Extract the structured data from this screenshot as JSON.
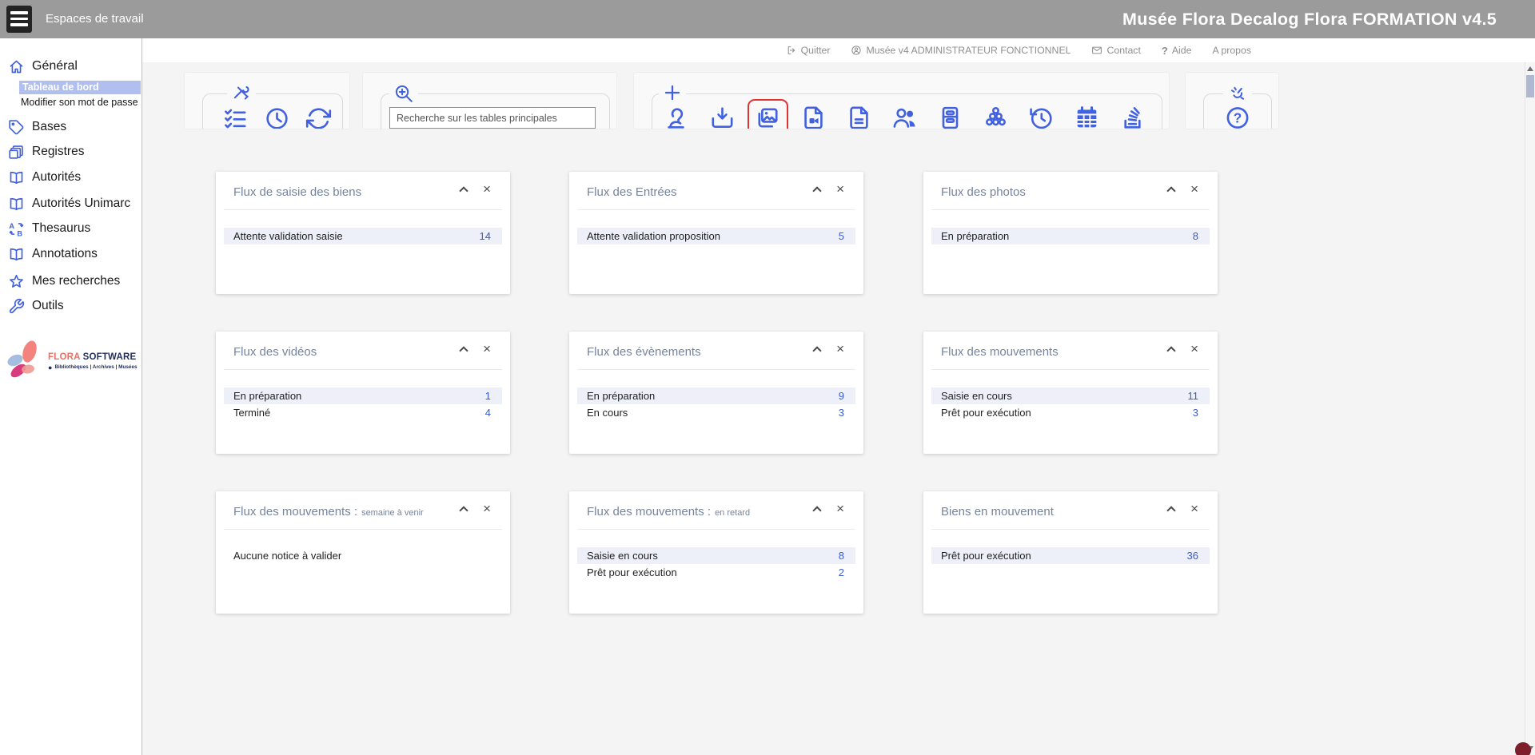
{
  "topbar": {
    "menu_label": "Espaces de travail",
    "title": "Musée Flora Decalog Flora FORMATION v4.5"
  },
  "utility_bar": {
    "items": [
      {
        "icon": "logout-icon",
        "label": "Quitter"
      },
      {
        "icon": "user-circle-icon",
        "label": "Musée v4 ADMINISTRATEUR FONCTIONNEL"
      },
      {
        "icon": "mail-icon",
        "label": "Contact"
      },
      {
        "icon": "question-icon",
        "label": "Aide"
      },
      {
        "icon": "",
        "label": "A propos"
      }
    ]
  },
  "sidebar": {
    "items": [
      {
        "label": "Général",
        "icon": "home-icon",
        "level": "section"
      },
      {
        "label": "Tableau de bord",
        "level": "sub",
        "selected": true
      },
      {
        "label": "Modifier son mot de passe",
        "level": "sub"
      },
      {
        "label": "Bases",
        "icon": "tag-icon"
      },
      {
        "label": "Registres",
        "icon": "registers-icon"
      },
      {
        "label": "Autorités",
        "icon": "book-open-icon"
      },
      {
        "label": "Autorités Unimarc",
        "icon": "book-open-icon"
      },
      {
        "label": "Thesaurus",
        "icon": "thesaurus-icon"
      },
      {
        "label": "Annotations",
        "icon": "book-open-icon"
      },
      {
        "label": "Mes recherches",
        "icon": "star-icon"
      },
      {
        "label": "Outils",
        "icon": "wrench-icon"
      }
    ],
    "logo": {
      "brand_primary": "FLORA",
      "brand_secondary": "SOFTWARE",
      "bullet": "●",
      "tagline": "Bibliothèques | Archives | Musées"
    }
  },
  "toolbar": {
    "search_placeholder": "Recherche sur les tables principales",
    "groups": [
      {
        "name": "display-options",
        "legend_icon": "tools-icon",
        "icons": [
          "checklist-icon",
          "clock-icon",
          "refresh-icon"
        ]
      },
      {
        "name": "search",
        "legend_icon": "zoom-plus-icon",
        "icons": []
      },
      {
        "name": "create-and-modules",
        "legend_icon": "plus-icon",
        "icons": [
          "bust-icon",
          "import-icon",
          "photos-icon",
          "video-doc-icon",
          "text-doc-icon",
          "people-icon",
          "cabinet-icon",
          "cluster-icon",
          "history-icon",
          "calendar-icon",
          "stack-icon"
        ],
        "highlighted_icon": "photos-icon"
      },
      {
        "name": "help",
        "legend_icon": "snap-fingers-icon",
        "icons": [
          "help-icon"
        ]
      }
    ]
  },
  "cards": [
    {
      "title": "Flux de saisie des biens",
      "rows": [
        {
          "label": "Attente validation saisie",
          "value": "14"
        }
      ]
    },
    {
      "title": "Flux des Entrées",
      "rows": [
        {
          "label": "Attente validation proposition",
          "value": "5"
        }
      ]
    },
    {
      "title": "Flux des photos",
      "rows": [
        {
          "label": "En préparation",
          "value": "8"
        }
      ]
    },
    {
      "title": "Flux des vidéos",
      "rows": [
        {
          "label": "En préparation",
          "value": "1"
        },
        {
          "label": "Terminé",
          "value": "4"
        }
      ]
    },
    {
      "title": "Flux des évènements",
      "rows": [
        {
          "label": "En préparation",
          "value": "9"
        },
        {
          "label": "En cours",
          "value": "3"
        }
      ]
    },
    {
      "title": "Flux des mouvements",
      "rows": [
        {
          "label": "Saisie en cours",
          "value": "11"
        },
        {
          "label": "Prêt pour exécution",
          "value": "3"
        }
      ]
    },
    {
      "title": "Flux des mouvements :",
      "suffix": "semaine à venir",
      "message": "Aucune notice à valider",
      "rows": []
    },
    {
      "title": "Flux des mouvements :",
      "suffix": "en retard",
      "rows": [
        {
          "label": "Saisie en cours",
          "value": "8"
        },
        {
          "label": "Prêt pour exécution",
          "value": "2"
        }
      ]
    },
    {
      "title": "Biens en mouvement",
      "rows": [
        {
          "label": "Prêt pour exécution",
          "value": "36"
        }
      ]
    }
  ],
  "glyphs": {
    "close": "×"
  },
  "colors": {
    "accent_blue": "#4161e1",
    "topbar_gray": "#9b9b9b",
    "selected_item_bg": "#b0bfee",
    "card_title": "#76849e",
    "value_blue": "#3a5bd2",
    "row_highlight": "#edf0f8",
    "highlight_red": "#e23333",
    "brand_coral": "#ee6f64",
    "brand_navy": "#232f5e",
    "indicator_dot": "#7e1f2b"
  }
}
